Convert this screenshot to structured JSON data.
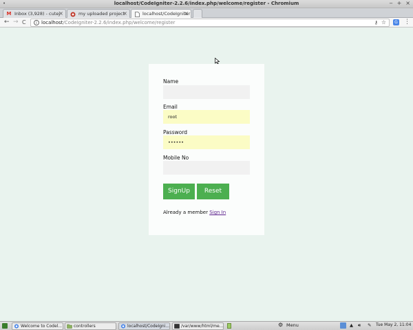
{
  "window": {
    "title": "localhost/CodeIgniter-2.2.6/index.php/welcome/register - Chromium",
    "menu_glyph": "•",
    "minimize": "‒",
    "maximize": "+",
    "close": "×"
  },
  "tabs": [
    {
      "label": "Inbox (3,928) - cutej",
      "icon": "gmail-icon",
      "active": false
    },
    {
      "label": "my uploaded project",
      "icon": "page-icon",
      "active": false
    },
    {
      "label": "localhost/CodeIgniter",
      "icon": "document-icon",
      "active": true
    }
  ],
  "toolbar": {
    "back": "←",
    "forward": "→",
    "reload": "C",
    "url_host": "localhost",
    "url_path": "/CodeIgniter-2.2.6/index.php/welcome/register",
    "info_glyph": "i",
    "key_glyph": "⚷",
    "star_glyph": "☆",
    "translate_glyph": "G",
    "menu_glyph": "⋮"
  },
  "form": {
    "name_label": "Name",
    "name_value": "",
    "email_label": "Email",
    "email_value": "root",
    "password_label": "Password",
    "password_value": "••••••",
    "mobile_label": "Mobile No",
    "mobile_value": "",
    "signup_label": "SignUp",
    "reset_label": "Reset",
    "member_text": "Already a member",
    "signin_link": "Sign In"
  },
  "taskbar": {
    "items": [
      {
        "label": "Welcome to Codel...",
        "icon": "chromium-icon"
      },
      {
        "label": "controllers",
        "icon": "folder-icon"
      },
      {
        "label": "localhost/CodeIgni...",
        "icon": "chromium-icon"
      },
      {
        "label": "/var/www/html/me...",
        "icon": "terminal-icon"
      }
    ],
    "menu_label": "Menu",
    "clock": "Tue May  2, 11:04"
  },
  "colors": {
    "page_bg": "#e9f3ee",
    "card_bg": "#fbfdfc",
    "input_bg": "#f1f1f1",
    "autofill_bg": "#fbfcc5",
    "button_bg": "#4caf50",
    "link": "#5a1f8c"
  }
}
